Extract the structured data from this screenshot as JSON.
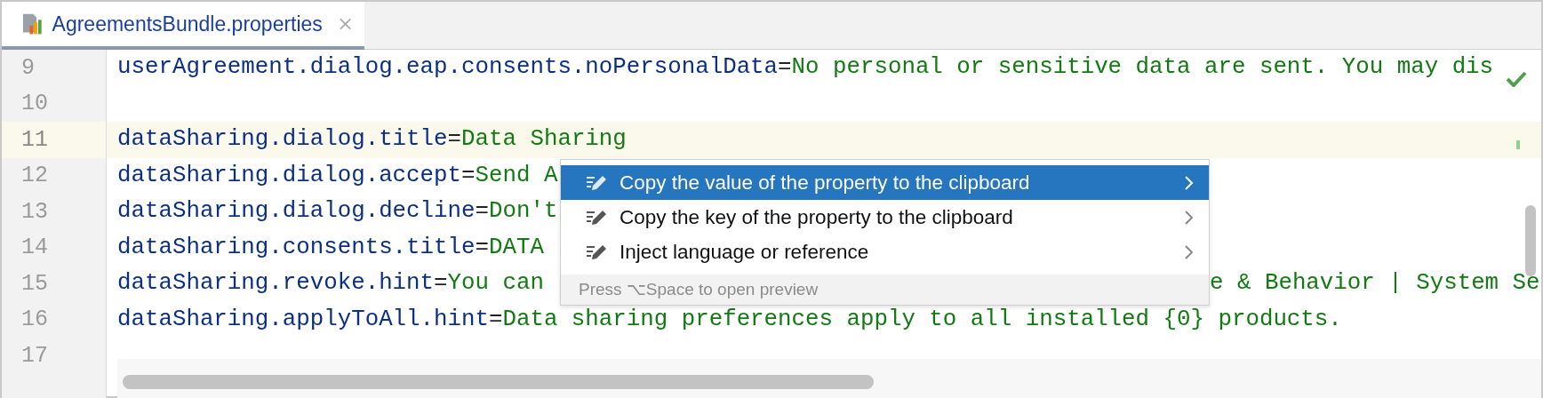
{
  "tab": {
    "title": "AgreementsBundle.properties",
    "selected": true
  },
  "lines": [
    {
      "number": "9",
      "key": "userAgreement.dialog.eap.consents.noPersonalData",
      "sep": "=",
      "value": "No personal or sensitive data are sent. You may dis",
      "current": false
    },
    {
      "number": "10",
      "current": false
    },
    {
      "number": "11",
      "key": "dataSharing.dialog.title",
      "sep": "=",
      "value": "Data Sharing",
      "current": true
    },
    {
      "number": "12",
      "key": "dataSharing.dialog.accept",
      "sep": "=",
      "value": "Send A",
      "current": false
    },
    {
      "number": "13",
      "key": "dataSharing.dialog.decline",
      "sep": "=",
      "value": "Don't",
      "current": false
    },
    {
      "number": "14",
      "key": "dataSharing.consents.title",
      "sep": "=",
      "value": "DATA",
      "current": false
    },
    {
      "number": "15",
      "key": "dataSharing.revoke.hint",
      "sep": "=",
      "value": "You can",
      "tail": "e & Behavior | System Se",
      "current": false
    },
    {
      "number": "16",
      "key": "dataSharing.applyToAll.hint",
      "sep": "=",
      "value": "Data sharing preferences apply to all installed {0} products.",
      "current": false
    },
    {
      "number": "17",
      "current": false
    }
  ],
  "popup": {
    "items": [
      {
        "label": "Copy the value of the property to the clipboard",
        "selected": true
      },
      {
        "label": "Copy the key of the property to the clipboard",
        "selected": false
      },
      {
        "label": "Inject language or reference",
        "selected": false
      }
    ],
    "footer": "Press ⌥Space to open preview"
  }
}
